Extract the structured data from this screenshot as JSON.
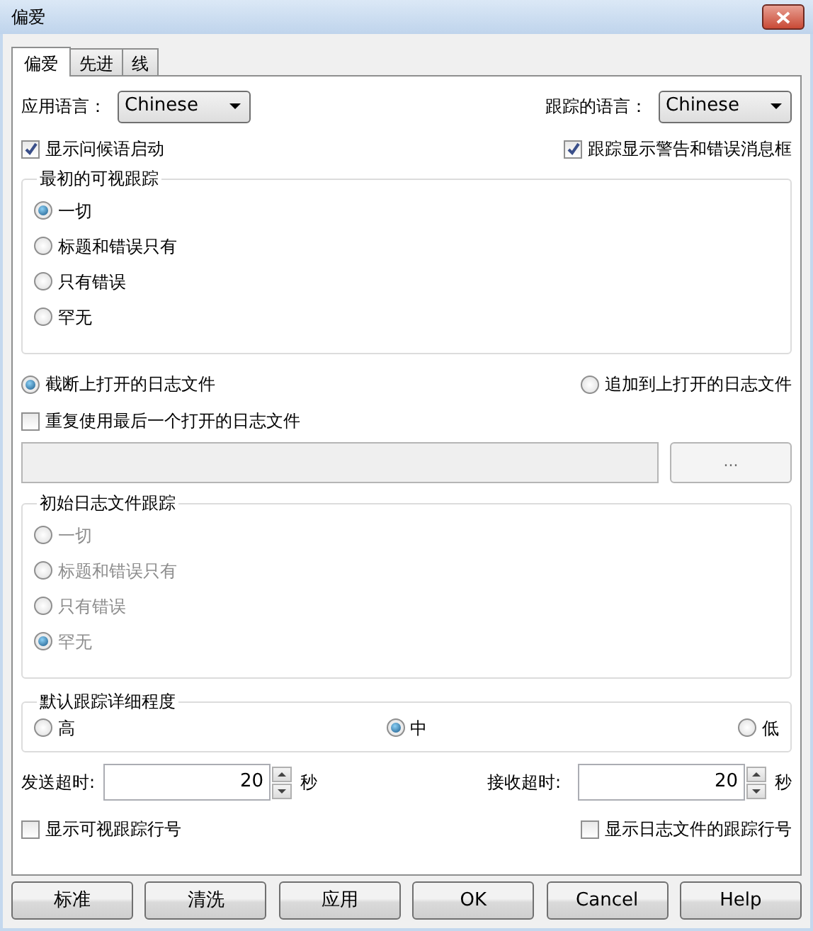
{
  "window": {
    "title": "偏爱"
  },
  "tabs": [
    {
      "label": "偏爱",
      "selected": true
    },
    {
      "label": "先进",
      "selected": false
    },
    {
      "label": "线",
      "selected": false
    }
  ],
  "app_language": {
    "label": "应用语言：",
    "value": "Chinese"
  },
  "trace_language": {
    "label": "跟踪的语言：",
    "value": "Chinese"
  },
  "show_greeting": {
    "label": "显示问候语启动",
    "checked": true
  },
  "trace_show_messages": {
    "label": "跟踪显示警告和错误消息框",
    "checked": true
  },
  "initial_visual_trace": {
    "title": "最初的可视跟踪",
    "disabled": false,
    "options": [
      {
        "label": "一切",
        "selected": true
      },
      {
        "label": "标题和错误只有",
        "selected": false
      },
      {
        "label": "只有错误",
        "selected": false
      },
      {
        "label": "罕无",
        "selected": false
      }
    ]
  },
  "log_mode": [
    {
      "label": "截断上打开的日志文件",
      "selected": true
    },
    {
      "label": "追加到上打开的日志文件",
      "selected": false
    }
  ],
  "reuse_log": {
    "label": "重复使用最后一个打开的日志文件",
    "checked": false
  },
  "log_path": {
    "disabled": true,
    "browse_label": "..."
  },
  "initial_log_trace": {
    "title": "初始日志文件跟踪",
    "disabled": true,
    "options": [
      {
        "label": "一切",
        "selected": false
      },
      {
        "label": "标题和错误只有",
        "selected": false
      },
      {
        "label": "只有错误",
        "selected": false
      },
      {
        "label": "罕无",
        "selected": true
      }
    ]
  },
  "default_detail": {
    "title": "默认跟踪详细程度",
    "options": [
      {
        "label": "高",
        "selected": false
      },
      {
        "label": "中",
        "selected": true
      },
      {
        "label": "低",
        "selected": false
      }
    ]
  },
  "send_timeout": {
    "label": "发送超时:",
    "value": "20",
    "unit": "秒"
  },
  "receive_timeout": {
    "label": "接收超时:",
    "value": "20",
    "unit": "秒"
  },
  "show_visual_line": {
    "label": "显示可视跟踪行号",
    "checked": false
  },
  "show_log_line": {
    "label": "显示日志文件的跟踪行号",
    "checked": false
  },
  "buttons": [
    "标准",
    "清洗",
    "应用",
    "OK",
    "Cancel",
    "Help"
  ]
}
